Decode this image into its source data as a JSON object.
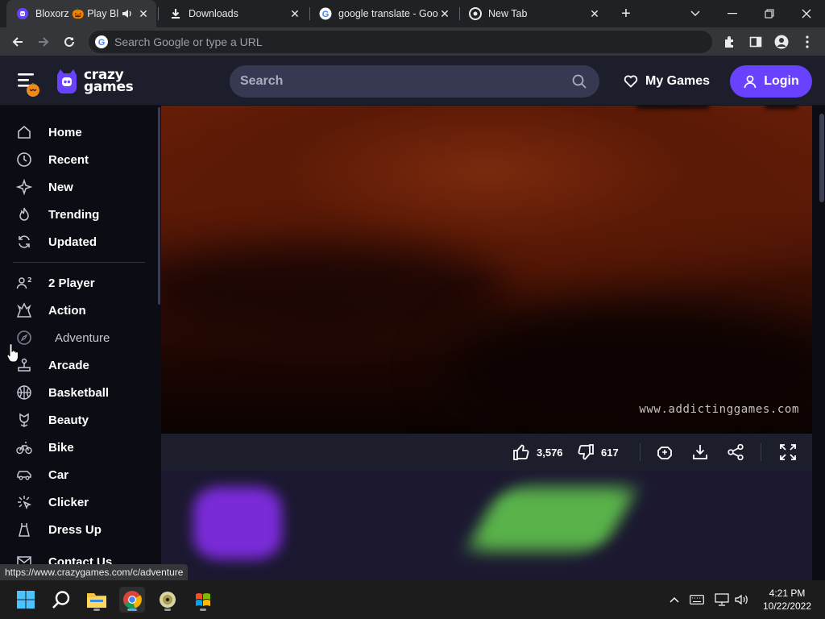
{
  "browser": {
    "tabs": [
      {
        "title": "Bloxorz 🎃 Play Bl",
        "active": true,
        "audio": true
      },
      {
        "title": "Downloads",
        "active": false
      },
      {
        "title": "google translate - Goo",
        "active": false
      },
      {
        "title": "New Tab",
        "active": false
      }
    ],
    "new_tab_label": "+",
    "omnibox_placeholder": "Search Google or type a URL"
  },
  "site": {
    "logo_text_line1": "crazy",
    "logo_text_line2": "games",
    "search_placeholder": "Search",
    "my_games_label": "My Games",
    "login_label": "Login",
    "accent_color": "#6842ff"
  },
  "sidebar": {
    "primary": [
      {
        "label": "Home",
        "icon": "home-icon"
      },
      {
        "label": "Recent",
        "icon": "clock-icon"
      },
      {
        "label": "New",
        "icon": "sparkle-icon"
      },
      {
        "label": "Trending",
        "icon": "flame-icon"
      },
      {
        "label": "Updated",
        "icon": "refresh-icon"
      }
    ],
    "categories": [
      {
        "label": "2 Player",
        "icon": "two-player-icon"
      },
      {
        "label": "Action",
        "icon": "explosion-icon"
      },
      {
        "label": "Adventure",
        "icon": "compass-icon",
        "hovered": true
      },
      {
        "label": "Arcade",
        "icon": "joystick-icon"
      },
      {
        "label": "Basketball",
        "icon": "basketball-icon"
      },
      {
        "label": "Beauty",
        "icon": "flower-icon"
      },
      {
        "label": "Bike",
        "icon": "bike-icon"
      },
      {
        "label": "Car",
        "icon": "car-icon"
      },
      {
        "label": "Clicker",
        "icon": "clicker-icon"
      },
      {
        "label": "Dress Up",
        "icon": "dress-icon"
      },
      {
        "label": "Contact Us",
        "icon": "mail-icon"
      }
    ]
  },
  "game": {
    "watermark": "www.addictinggames.com",
    "likes": "3,576",
    "dislikes": "617"
  },
  "status_url": "https://www.crazygames.com/c/adventure",
  "taskbar": {
    "time": "4:21 PM",
    "date": "10/22/2022"
  }
}
